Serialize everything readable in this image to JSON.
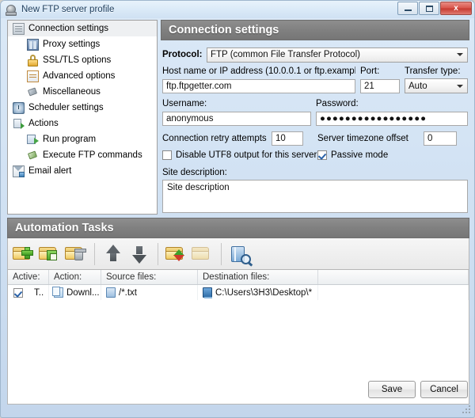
{
  "window": {
    "title": "New FTP server profile",
    "icon": "globe-icon",
    "minimize_label": "Minimize",
    "maximize_label": "Maximize",
    "close_label": "x"
  },
  "sidebar": {
    "items": [
      {
        "label": "Connection settings",
        "icon": "document-icon",
        "level": 0,
        "selected": true
      },
      {
        "label": "Proxy settings",
        "icon": "proxy-icon",
        "level": 1,
        "selected": false
      },
      {
        "label": "SSL/TLS options",
        "icon": "lock-icon",
        "level": 1,
        "selected": false
      },
      {
        "label": "Advanced options",
        "icon": "advanced-icon",
        "level": 1,
        "selected": false
      },
      {
        "label": "Miscellaneous",
        "icon": "tag-icon",
        "level": 1,
        "selected": false
      },
      {
        "label": "Scheduler settings",
        "icon": "clock-icon",
        "level": 0,
        "selected": false
      },
      {
        "label": "Actions",
        "icon": "actions-icon",
        "level": 0,
        "selected": false
      },
      {
        "label": "Run program",
        "icon": "run-program-icon",
        "level": 1,
        "selected": false
      },
      {
        "label": "Execute FTP commands",
        "icon": "ftp-command-icon",
        "level": 1,
        "selected": false
      },
      {
        "label": "Email alert",
        "icon": "mail-icon",
        "level": 0,
        "selected": false
      }
    ]
  },
  "connection": {
    "header": "Connection settings",
    "protocol_label": "Protocol:",
    "protocol_value": "FTP (common File Transfer Protocol)",
    "host_label": "Host name or IP address (10.0.0.1 or ftp.exampl",
    "host_value": "ftp.ftpgetter.com",
    "port_label": "Port:",
    "port_value": "21",
    "transfer_type_label": "Transfer type:",
    "transfer_type_value": "Auto",
    "username_label": "Username:",
    "username_value": "anonymous",
    "password_label": "Password:",
    "password_value": "●●●●●●●●●●●●●●●●●",
    "retry_label": "Connection retry attempts",
    "retry_value": "10",
    "timezone_label": "Server timezone offset",
    "timezone_value": "0",
    "utf8_label": "Disable UTF8 output for this server",
    "utf8_checked": false,
    "passive_label": "Passive mode",
    "passive_checked": true,
    "site_description_label": "Site description:",
    "site_description_value": "Site description"
  },
  "tasks": {
    "header": "Automation Tasks",
    "toolbar": [
      {
        "name": "add-task-button",
        "icon": "folder-add-icon"
      },
      {
        "name": "edit-task-button",
        "icon": "folder-edit-icon"
      },
      {
        "name": "delete-task-button",
        "icon": "folder-delete-icon"
      },
      {
        "name": "move-up-button",
        "icon": "arrow-up-icon"
      },
      {
        "name": "move-down-button",
        "icon": "arrow-down-icon"
      },
      {
        "name": "sync-task-button",
        "icon": "folder-sync-icon"
      },
      {
        "name": "sync-disabled-button",
        "icon": "folder-sync-disabled-icon"
      },
      {
        "name": "preview-button",
        "icon": "book-search-icon"
      }
    ],
    "columns": [
      "Active:",
      "Action:",
      "Source files:",
      "Destination files:",
      ""
    ],
    "rows": [
      {
        "active": true,
        "type": "T..",
        "action": "Downl...",
        "source": "/*.txt",
        "destination": "C:\\Users\\3H3\\Desktop\\*"
      }
    ]
  },
  "footer": {
    "save_label": "Save",
    "cancel_label": "Cancel"
  },
  "colors": {
    "header_gray": "#808080",
    "title_blue": "#dcebf8",
    "close_red": "#d9564c",
    "accent_blue": "#2a62a8"
  }
}
